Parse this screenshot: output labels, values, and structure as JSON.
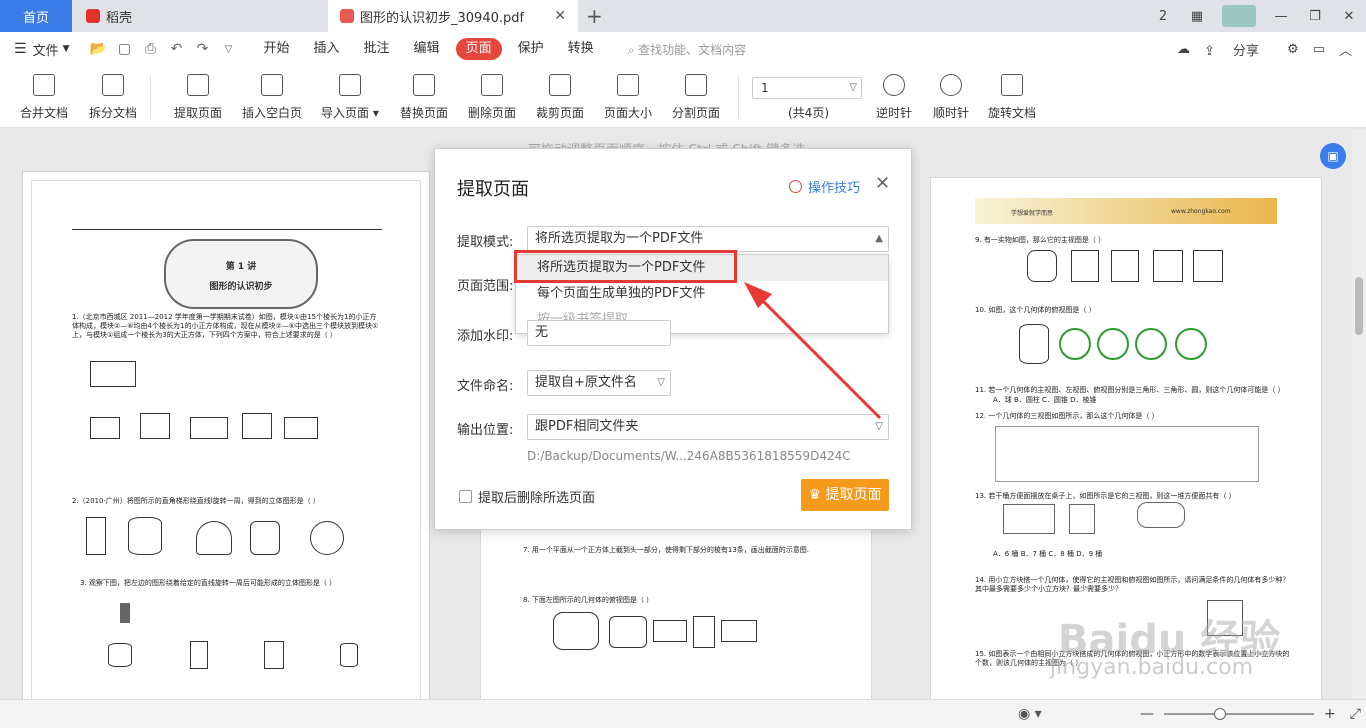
{
  "tabs": {
    "home": "首页",
    "docer": "稻壳",
    "pdf": "图形的认识初步_30940.pdf",
    "badge": "2"
  },
  "menu": {
    "file": "文件",
    "items": [
      "开始",
      "插入",
      "批注",
      "编辑",
      "页面",
      "保护",
      "转换"
    ],
    "active_index": 4,
    "search": "查找功能、文档内容",
    "share": "分享"
  },
  "toolbar": {
    "tools": [
      "合并文档",
      "拆分文档",
      "提取页面",
      "插入空白页",
      "导入页面",
      "替换页面",
      "删除页面",
      "裁剪页面",
      "页面大小",
      "分割页面",
      "逆时针",
      "顺时针",
      "旋转文档"
    ],
    "page_value": "1",
    "page_count": "(共4页)"
  },
  "content": {
    "hint": "可拖动调整页面顺序，按住 Ctrl 或 Shift 键多选",
    "left_page": {
      "lecture": "第 1 讲",
      "title": "图形的认识初步",
      "q1": "1.（北京市西城区 2011—2012 学年度第一学期期末试卷）如图，模块①由15个棱长为1的小正方体构成，模块②—⑥均由4个棱长为1的小正方体构成，现在从模块②—⑥中选出三个模块放到模块①上，与模块①组成一个棱长为3的大正方体，下列四个方案中，符合上述要求的是（ ）",
      "q2": "2.（2010·广州）将图所示的直角梯形绕直线l旋转一周，得到的立体图形是（ ）",
      "q3": "3. 观察下图，把左边的图形绕着给定的直线旋转一周后可能形成的立体图形是（ ）"
    },
    "mid_page": {
      "q7": "7. 用一个平面从一个正方体上截到头一部分，使得剩下部分的棱有13条，画出截面的示意图.",
      "q8": "8. 下面左图所示的几何体的俯视图是（ ）"
    },
    "right_page": {
      "header_left": "学想爱就学而思",
      "header_right": "www.zhongkao.com",
      "q9": "9. 有一实物如图，那么它的主视图是（ ）",
      "q10": "10. 如图，这个几何体的俯视图是（ ）",
      "q11": "11. 若一个几何体的主视图、左视图、俯视图分别是三角形、三角形、圆，则这个几何体可能是（ ）",
      "q11_opts": "A．球    B．圆柱    C．圆锥    D．棱锥",
      "q12": "12. 一个几何体的三视图如图所示，那么这个几何体是（ ）",
      "q13": "13. 若干桶方便面摆放在桌子上，如图所示是它的三视图，则这一堆方便面共有（ ）",
      "q13_opts": "A．6 桶    B．7 桶    C．8 桶    D．9 桶",
      "q14": "14. 用小立方块搭一个几何体，使得它的主视图和俯视图如图所示，请问满足条件的几何体有多少种？其中最多需要多少个小立方块？最少需要多少？",
      "q15": "15. 如图表示一个由相同小立方块搭成的几何体的俯视图，小正方形中的数字表示该位置上小立方块的个数，则该几何体的主视图为（ ）"
    },
    "watermark": "Baidu 经验",
    "watermark_url": "jingyan.baidu.com"
  },
  "dialog": {
    "title": "提取页面",
    "tips": "操作技巧",
    "mode_label": "提取模式:",
    "mode_value": "将所选页提取为一个PDF文件",
    "mode_options": [
      "将所选页提取为一个PDF文件",
      "每个页面生成单独的PDF文件",
      "按一级书签提取"
    ],
    "range_label": "页面范围:",
    "watermark_label": "添加水印:",
    "watermark_value": "无",
    "naming_label": "文件命名:",
    "naming_value": "提取自+原文件名",
    "output_label": "输出位置:",
    "output_value": "跟PDF相同文件夹",
    "output_path": "D:/Backup/Documents/W...246A8B5361818559D424C",
    "delete_checkbox": "提取后删除所选页面",
    "extract_button": "提取页面"
  },
  "colors": {
    "accent_blue": "#3c7ce8",
    "active_tab_red": "#e6463d",
    "button_orange": "#f59a1b",
    "annotation_red": "#e53935"
  }
}
